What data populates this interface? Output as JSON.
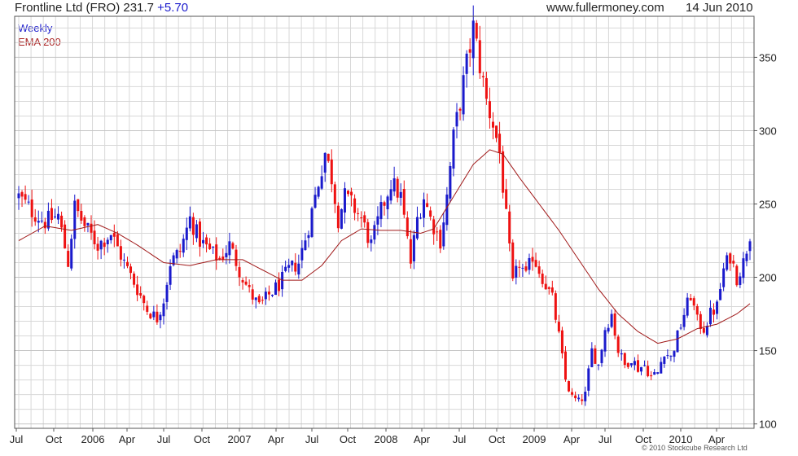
{
  "header": {
    "instrument": "Frontline Ltd (FRO)",
    "last": "231.7",
    "change": "+5.70",
    "site": "www.fullermoney.com",
    "date": "14 Jun 2010"
  },
  "legend": {
    "weekly": "Weekly",
    "ema": "EMA 200"
  },
  "copyright": "© 2010 Stockcube Research Ltd",
  "colors": {
    "up": "#1a1acc",
    "down": "#ee1111",
    "ema": "#a01818",
    "grid": "#d8d8d8",
    "frame": "#555555"
  },
  "chart_data": {
    "type": "candlestick",
    "title": "Frontline Ltd (FRO) 231.7 +5.70",
    "frequency": "Weekly",
    "x_tick_labels": [
      "Jul",
      "Oct",
      "2006",
      "Apr",
      "Jul",
      "Oct",
      "2007",
      "Apr",
      "Jul",
      "Oct",
      "2008",
      "Apr",
      "Jul",
      "Oct",
      "2009",
      "Apr",
      "Jul",
      "Oct",
      "2010",
      "Apr"
    ],
    "y_ticks": [
      100,
      150,
      200,
      250,
      300,
      350
    ],
    "ylim": [
      97,
      378
    ],
    "y_axis_side": "right",
    "grid": true,
    "price_anchors": [
      [
        0,
        255
      ],
      [
        4,
        245
      ],
      [
        8,
        238
      ],
      [
        12,
        242
      ],
      [
        15,
        210
      ],
      [
        17,
        248
      ],
      [
        20,
        235
      ],
      [
        24,
        222
      ],
      [
        28,
        230
      ],
      [
        32,
        210
      ],
      [
        36,
        192
      ],
      [
        39,
        178
      ],
      [
        42,
        172
      ],
      [
        44,
        185
      ],
      [
        46,
        210
      ],
      [
        49,
        218
      ],
      [
        52,
        240
      ],
      [
        55,
        225
      ],
      [
        58,
        218
      ],
      [
        61,
        212
      ],
      [
        64,
        222
      ],
      [
        67,
        205
      ],
      [
        70,
        190
      ],
      [
        73,
        180
      ],
      [
        76,
        188
      ],
      [
        79,
        195
      ],
      [
        82,
        205
      ],
      [
        85,
        210
      ],
      [
        88,
        235
      ],
      [
        91,
        265
      ],
      [
        93,
        285
      ],
      [
        95,
        268
      ],
      [
        97,
        240
      ],
      [
        99,
        255
      ],
      [
        101,
        250
      ],
      [
        104,
        240
      ],
      [
        107,
        222
      ],
      [
        110,
        245
      ],
      [
        113,
        265
      ],
      [
        116,
        255
      ],
      [
        119,
        210
      ],
      [
        121,
        240
      ],
      [
        123,
        255
      ],
      [
        125,
        240
      ],
      [
        128,
        225
      ],
      [
        130,
        255
      ],
      [
        132,
        295
      ],
      [
        134,
        320
      ],
      [
        136,
        345
      ],
      [
        138,
        370
      ],
      [
        140,
        345
      ],
      [
        142,
        320
      ],
      [
        144,
        305
      ],
      [
        146,
        285
      ],
      [
        148,
        240
      ],
      [
        150,
        195
      ],
      [
        152,
        210
      ],
      [
        154,
        200
      ],
      [
        156,
        215
      ],
      [
        158,
        205
      ],
      [
        160,
        195
      ],
      [
        162,
        185
      ],
      [
        164,
        160
      ],
      [
        166,
        130
      ],
      [
        168,
        118
      ],
      [
        170,
        115
      ],
      [
        172,
        120
      ],
      [
        174,
        150
      ],
      [
        176,
        140
      ],
      [
        178,
        165
      ],
      [
        180,
        175
      ],
      [
        182,
        150
      ],
      [
        184,
        140
      ],
      [
        186,
        145
      ],
      [
        188,
        138
      ],
      [
        190,
        140
      ],
      [
        192,
        132
      ],
      [
        194,
        135
      ],
      [
        196,
        150
      ],
      [
        198,
        145
      ],
      [
        200,
        160
      ],
      [
        202,
        175
      ],
      [
        204,
        188
      ],
      [
        206,
        170
      ],
      [
        208,
        165
      ],
      [
        210,
        175
      ],
      [
        212,
        180
      ],
      [
        214,
        205
      ],
      [
        216,
        215
      ],
      [
        218,
        200
      ],
      [
        220,
        210
      ],
      [
        222,
        230
      ]
    ],
    "ema200_anchors": [
      [
        0,
        225
      ],
      [
        8,
        235
      ],
      [
        16,
        232
      ],
      [
        24,
        236
      ],
      [
        30,
        230
      ],
      [
        36,
        222
      ],
      [
        44,
        210
      ],
      [
        52,
        208
      ],
      [
        60,
        212
      ],
      [
        68,
        212
      ],
      [
        74,
        205
      ],
      [
        80,
        198
      ],
      [
        86,
        198
      ],
      [
        92,
        208
      ],
      [
        98,
        225
      ],
      [
        104,
        233
      ],
      [
        110,
        232
      ],
      [
        116,
        232
      ],
      [
        122,
        230
      ],
      [
        126,
        233
      ],
      [
        132,
        255
      ],
      [
        138,
        277
      ],
      [
        143,
        287
      ],
      [
        147,
        284
      ],
      [
        152,
        268
      ],
      [
        158,
        250
      ],
      [
        164,
        232
      ],
      [
        170,
        212
      ],
      [
        176,
        192
      ],
      [
        182,
        175
      ],
      [
        188,
        163
      ],
      [
        194,
        155
      ],
      [
        200,
        158
      ],
      [
        206,
        165
      ],
      [
        212,
        168
      ],
      [
        218,
        175
      ],
      [
        222,
        182
      ]
    ],
    "last_close": 231.7,
    "last_change": 5.7
  }
}
